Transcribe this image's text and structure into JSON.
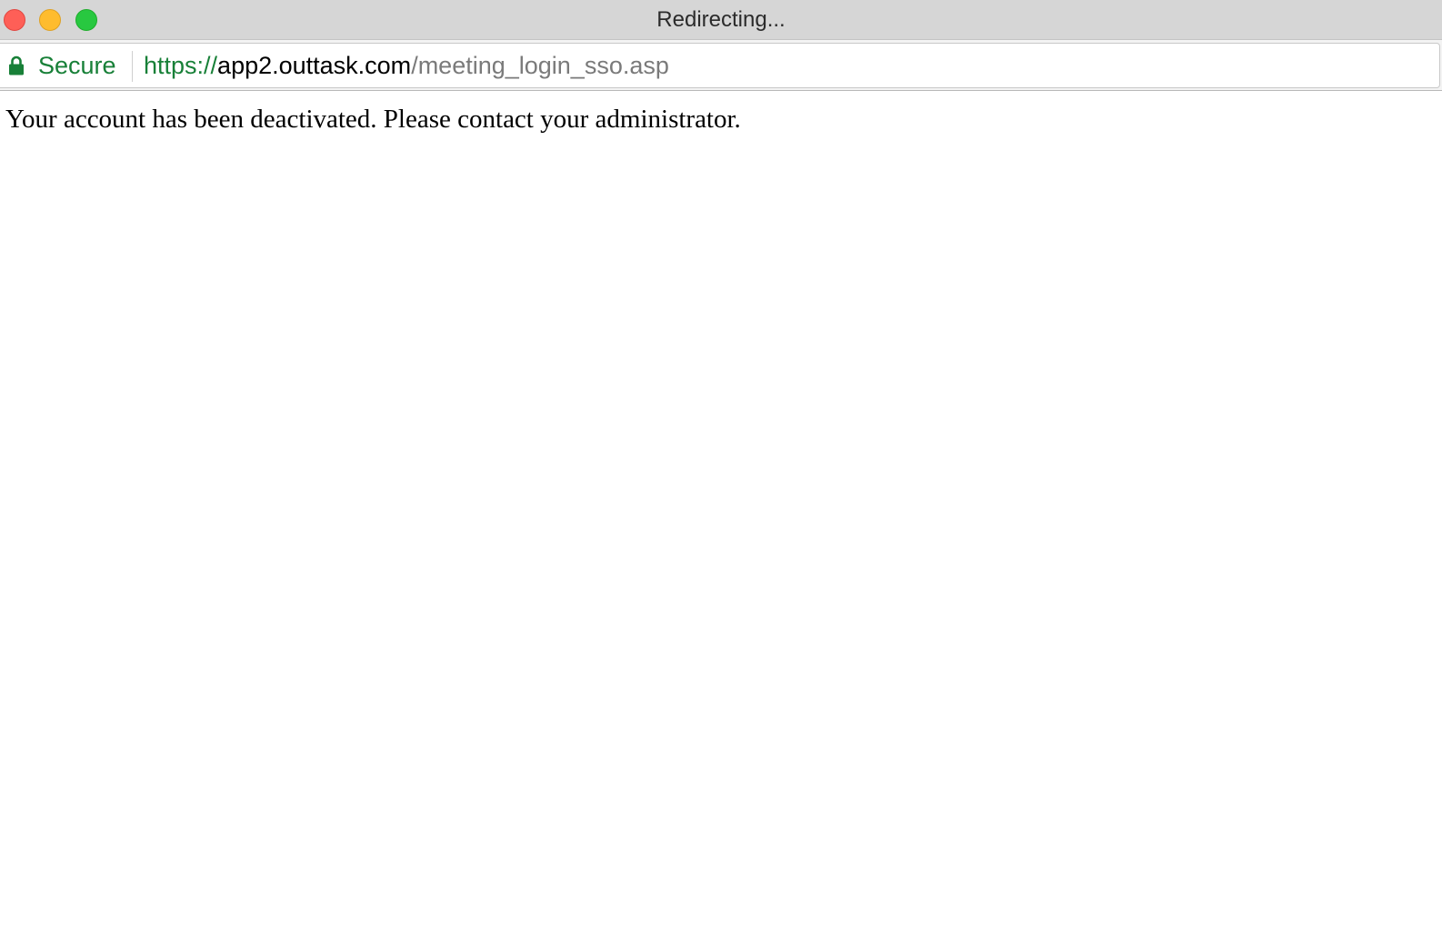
{
  "window": {
    "title": "Redirecting...",
    "controls": [
      "close",
      "minimize",
      "zoom"
    ]
  },
  "addressbar": {
    "security_label": "Secure",
    "security_icon": "lock-icon",
    "url": {
      "scheme": "https://",
      "host": "app2.outtask.com",
      "path": "/meeting_login_sso.asp"
    }
  },
  "page": {
    "message": "Your account has been deactivated. Please contact your administrator."
  },
  "colors": {
    "secure_green": "#188038",
    "close": "#fe5f57",
    "minimize": "#febc2e",
    "zoom": "#28c840"
  }
}
